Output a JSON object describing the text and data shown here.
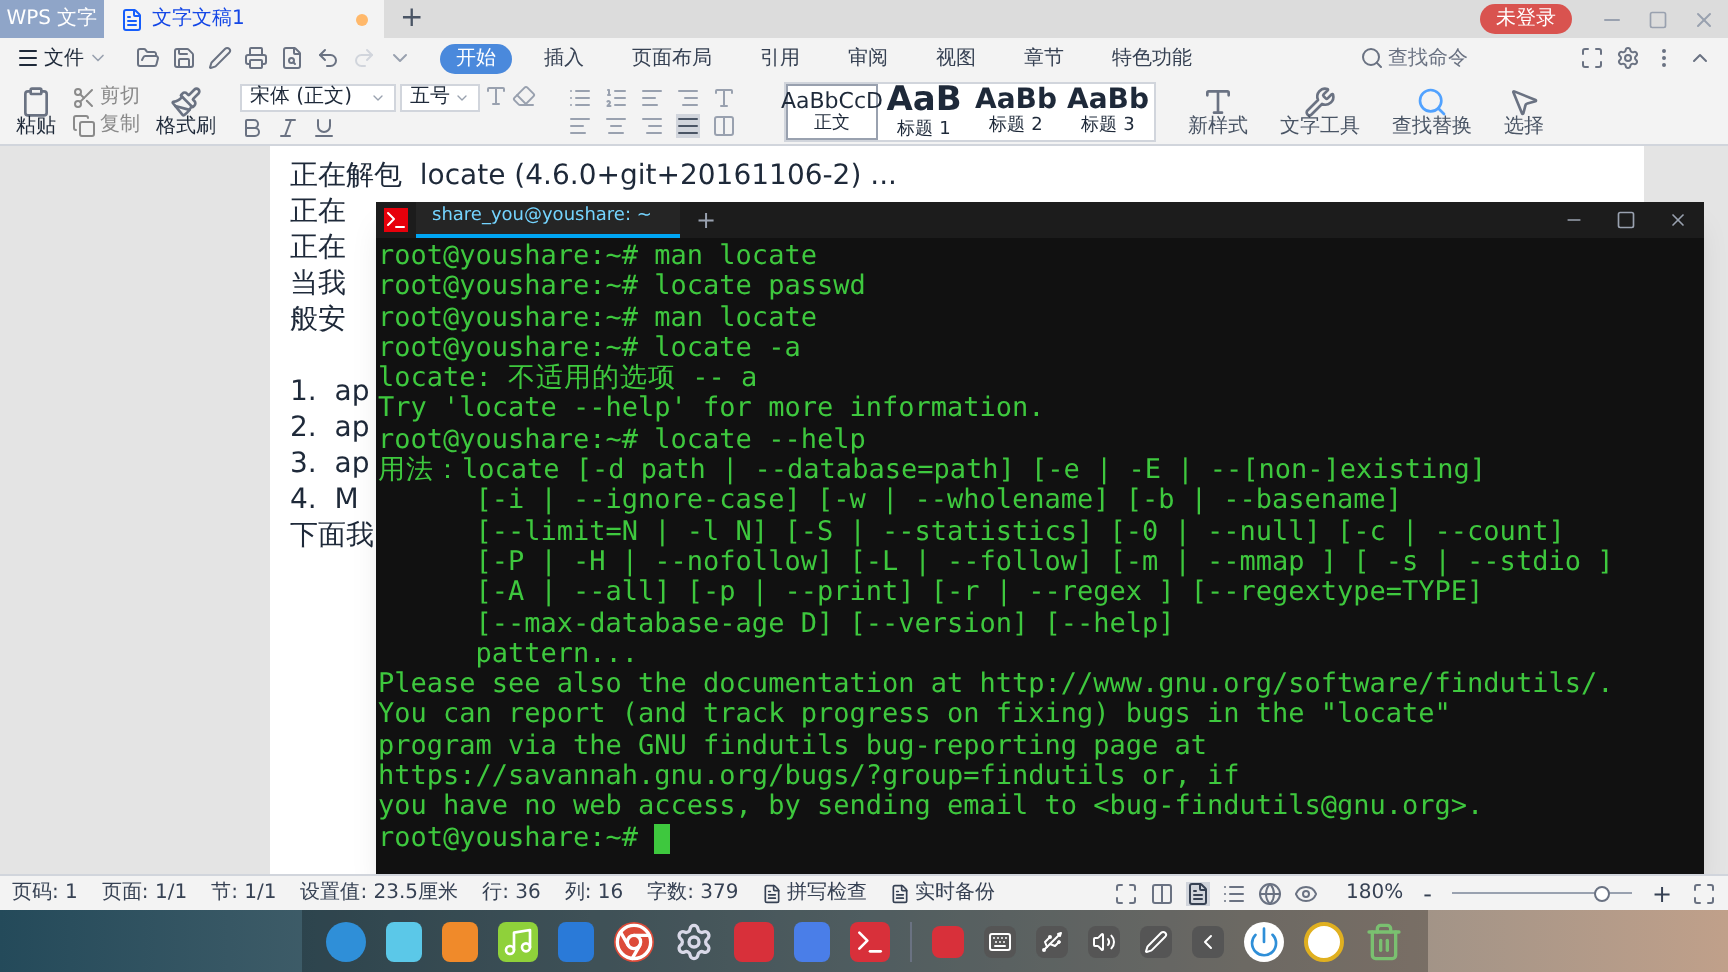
{
  "app_label": "WPS 文字",
  "doc_tabs": [
    {
      "label": "文字文稿1",
      "selected": true
    }
  ],
  "new_tab": "+",
  "login_badge": "未登录",
  "menu": {
    "file": "文件",
    "tabs": [
      {
        "label": "开始",
        "selected": true
      },
      {
        "label": "插入",
        "selected": false
      },
      {
        "label": "页面布局",
        "selected": false
      },
      {
        "label": "引用",
        "selected": false
      },
      {
        "label": "审阅",
        "selected": false
      },
      {
        "label": "视图",
        "selected": false
      },
      {
        "label": "章节",
        "selected": false
      },
      {
        "label": "特色功能",
        "selected": false
      }
    ],
    "search_placeholder": "查找命令"
  },
  "ribbon": {
    "paste": "粘贴",
    "clip": [
      {
        "label": "剪切",
        "disabled": true
      },
      {
        "label": "复制",
        "disabled": true
      }
    ],
    "format_painter": "格式刷",
    "font": "宋体 (正文)",
    "size": "五号",
    "styles": [
      {
        "preview": "AaBbCcD",
        "label": "正文",
        "kind": "normal"
      },
      {
        "preview": "AaB",
        "label": "标题 1",
        "kind": "h1"
      },
      {
        "preview": "AaBb",
        "label": "标题 2",
        "kind": "h2"
      },
      {
        "preview": "AaBb",
        "label": "标题 3",
        "kind": "h3"
      }
    ],
    "tools": [
      "新样式",
      "文字工具",
      "查找替换",
      "选择"
    ]
  },
  "document": {
    "intro": [
      "正在解包  locate (4.6.0+git+20161106-2) ...",
      "正在",
      "正在",
      "当我",
      "般安"
    ],
    "list": [
      "1.  ap",
      "2.  ap",
      "3.  ap",
      "4.  M"
    ],
    "outro": [
      "下面我"
    ]
  },
  "terminal": {
    "tab": "share_you@youshare: ~",
    "new_tab": "+",
    "lines": [
      "root@youshare:~# man locate",
      "root@youshare:~# locate passwd",
      "root@youshare:~# man locate",
      "root@youshare:~# locate -a",
      "locate: 不适用的选项 -- a",
      "Try 'locate --help' for more information.",
      "root@youshare:~# locate --help",
      "用法：locate [-d path | --database=path] [-e | -E | --[non-]existing]",
      "      [-i | --ignore-case] [-w | --wholename] [-b | --basename]",
      "      [--limit=N | -l N] [-S | --statistics] [-0 | --null] [-c | --count]",
      "      [-P | -H | --nofollow] [-L | --follow] [-m | --mmap ] [ -s | --stdio ]",
      "      [-A | --all] [-p | --print] [-r | --regex ] [--regextype=TYPE]",
      "      [--max-database-age D] [--version] [--help]",
      "      pattern...",
      "Please see also the documentation at http://www.gnu.org/software/findutils/.",
      "You can report (and track progress on fixing) bugs in the \"locate\"",
      "program via the GNU findutils bug-reporting page at",
      "https://savannah.gnu.org/bugs/?group=findutils or, if",
      "you have no web access, by sending email to <bug-findutils@gnu.org>.",
      "root@youshare:~# "
    ]
  },
  "status_bar": {
    "items": [
      "页码: 1",
      "页面: 1/1",
      "节: 1/1",
      "设置值: 23.5厘米",
      "行: 36",
      "列: 16",
      "字数: 379"
    ],
    "toggles": [
      "拼写检查",
      "实时备份"
    ],
    "zoom": "180%",
    "zoom_out": "-",
    "zoom_in": "+",
    "level": 0.83
  }
}
